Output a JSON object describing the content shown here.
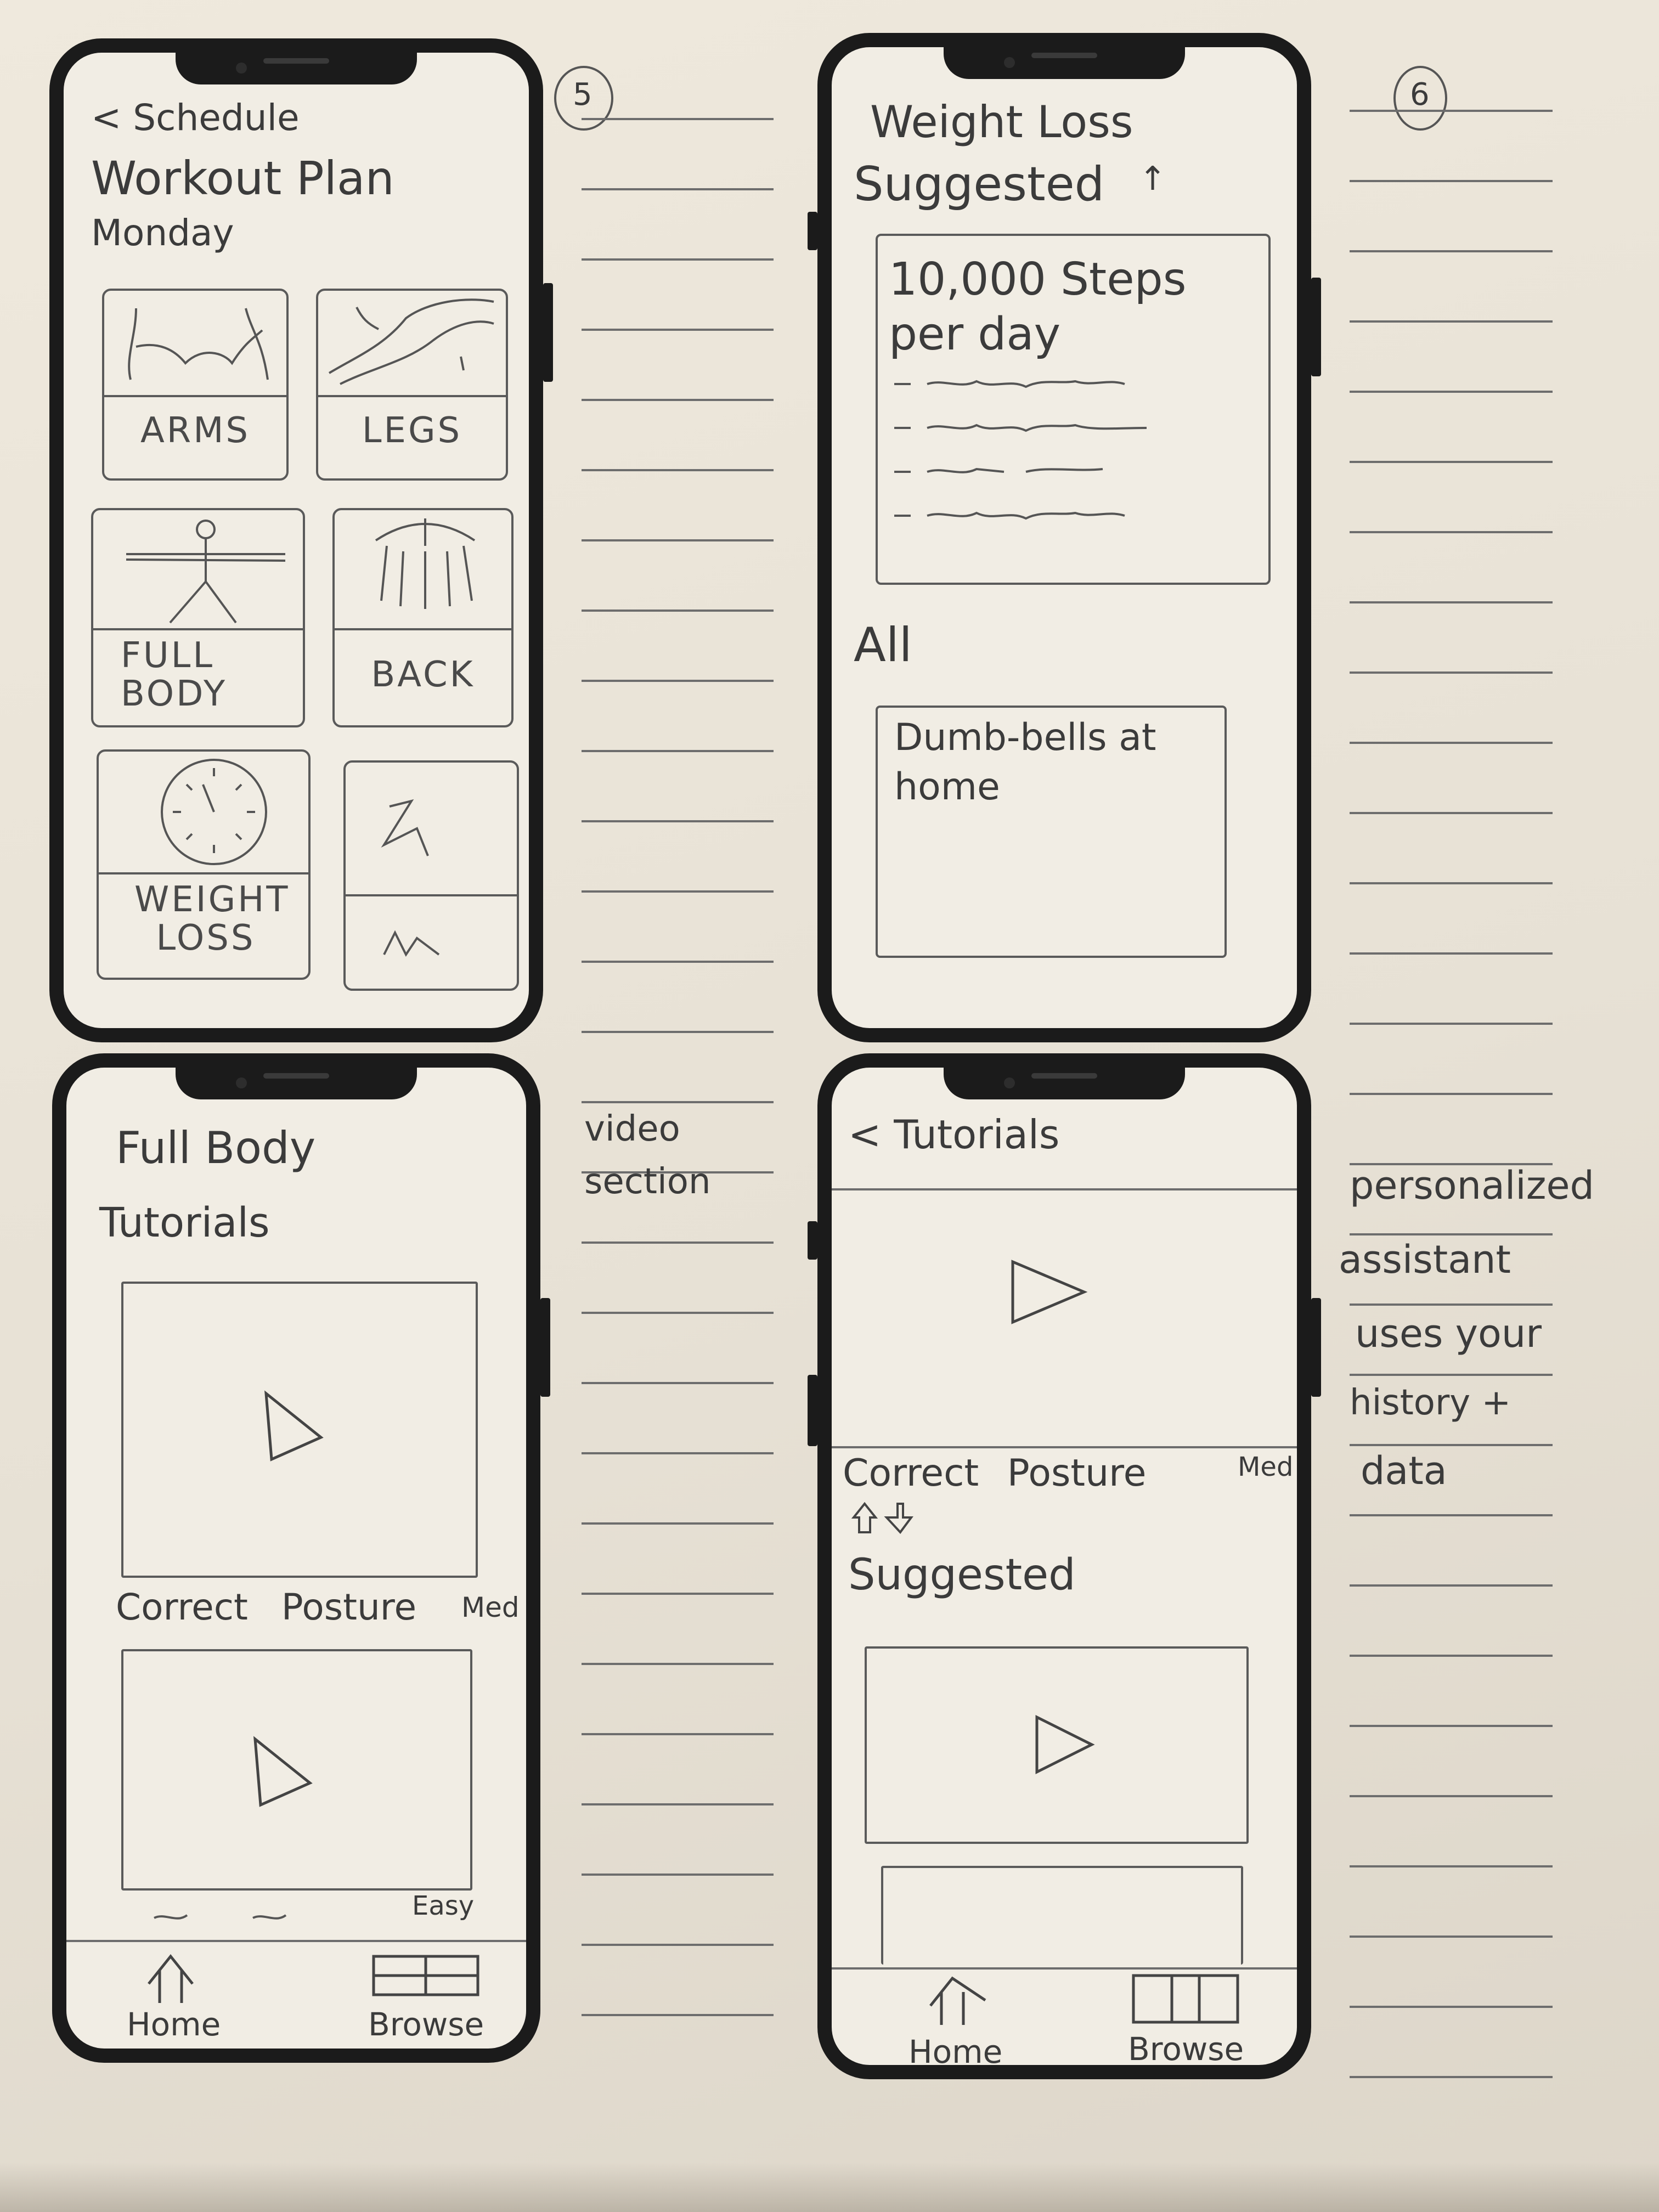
{
  "screens": {
    "schedule": {
      "back": "< Schedule",
      "title": "Workout Plan",
      "day": "Monday",
      "tiles": [
        {
          "label": "ARMS"
        },
        {
          "label": "LEGS"
        },
        {
          "label": "FULL BODY"
        },
        {
          "label": "BACK"
        },
        {
          "label": "WEIGHT LOSS"
        },
        {
          "label": ""
        }
      ]
    },
    "weight_loss": {
      "title": "Weight Loss",
      "suggested": "Suggested",
      "suggested_arrow": "↑",
      "card_title": "10,000 Steps per day",
      "all": "All",
      "card2_title": "Dumb-bells at home"
    },
    "full_body": {
      "title": "Full Body",
      "section": "Tutorials",
      "video1_title": "Correct Posture",
      "video1_level": "Med",
      "video2_level": "Easy",
      "nav": {
        "home": "Home",
        "browse": "Browse"
      }
    },
    "tutorials": {
      "back": "< Tutorials",
      "video_title": "Correct Posture",
      "video_level": "Med",
      "suggested": "Suggested",
      "nav": {
        "home": "Home",
        "browse": "Browse"
      }
    }
  },
  "notes": {
    "page_marker_1": "5",
    "page_marker_2": "6",
    "video_note": "video section",
    "assistant_note": [
      "personalized",
      "assistant",
      "uses your",
      "history +",
      "data"
    ]
  },
  "colors": {
    "paper": "#ece6da",
    "ink": "#3b3b3b",
    "frame": "#1b1b1b"
  }
}
